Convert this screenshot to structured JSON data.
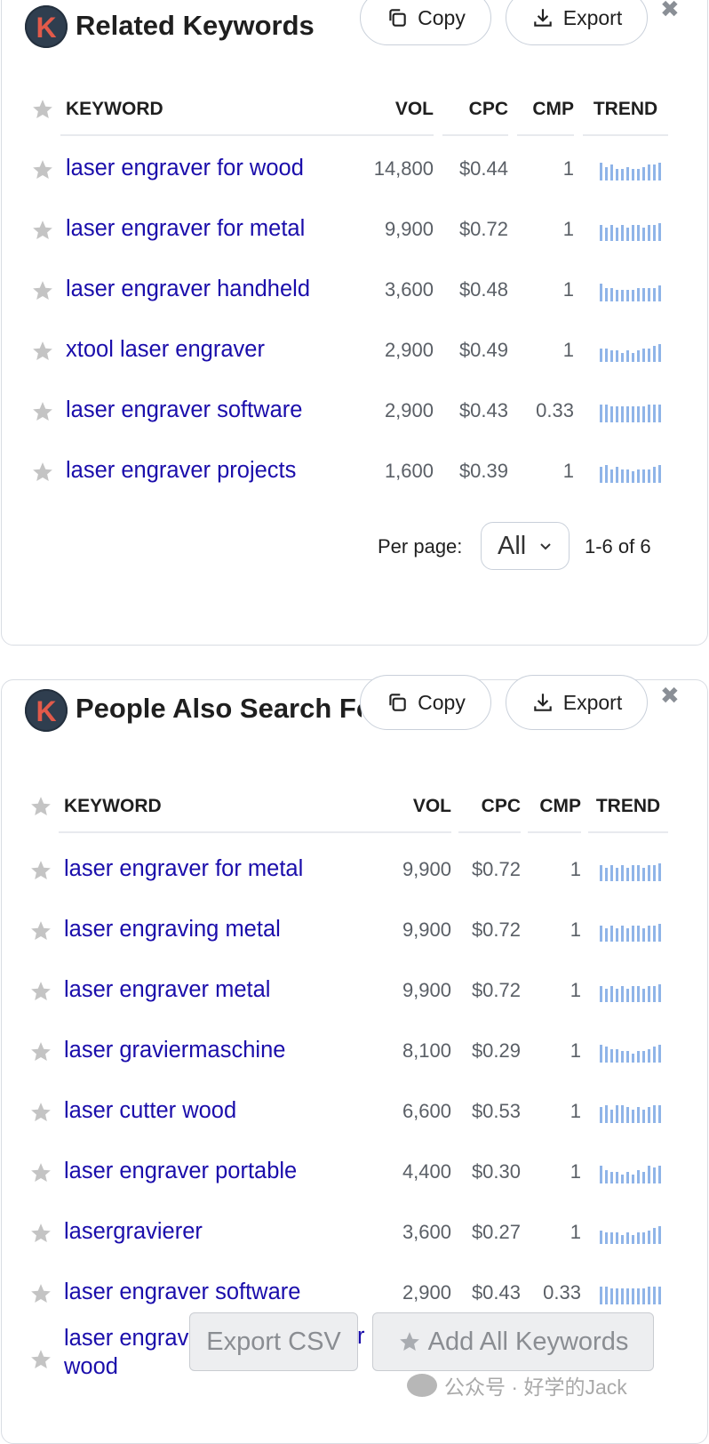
{
  "widgets": [
    {
      "title": "Related Keywords",
      "logo_letter": "K",
      "copy_label": "Copy",
      "export_label": "Export",
      "columns": {
        "keyword": "KEYWORD",
        "vol": "VOL",
        "cpc": "CPC",
        "cmp": "CMP",
        "trend": "TREND"
      },
      "rows": [
        {
          "keyword": "laser engraver for wood",
          "vol": "14,800",
          "cpc": "$0.44",
          "cmp": "1",
          "trend": [
            8,
            6,
            7,
            5,
            5,
            6,
            5,
            5,
            6,
            7,
            7,
            8
          ]
        },
        {
          "keyword": "laser engraver for metal",
          "vol": "9,900",
          "cpc": "$0.72",
          "cmp": "1",
          "trend": [
            7,
            6,
            7,
            6,
            7,
            6,
            7,
            7,
            6,
            7,
            7,
            8
          ]
        },
        {
          "keyword": "laser engraver handheld",
          "vol": "3,600",
          "cpc": "$0.48",
          "cmp": "1",
          "trend": [
            8,
            6,
            6,
            5,
            5,
            5,
            5,
            6,
            6,
            6,
            6,
            7
          ]
        },
        {
          "keyword": "xtool laser engraver",
          "vol": "2,900",
          "cpc": "$0.49",
          "cmp": "1",
          "trend": [
            6,
            6,
            5,
            5,
            4,
            5,
            4,
            5,
            6,
            6,
            7,
            8
          ]
        },
        {
          "keyword": "laser engraver software",
          "vol": "2,900",
          "cpc": "$0.43",
          "cmp": "0.33",
          "trend": [
            8,
            8,
            7,
            7,
            7,
            7,
            7,
            7,
            7,
            8,
            8,
            8
          ]
        },
        {
          "keyword": "laser engraver projects",
          "vol": "1,600",
          "cpc": "$0.39",
          "cmp": "1",
          "trend": [
            7,
            8,
            6,
            7,
            6,
            6,
            5,
            6,
            6,
            6,
            7,
            8
          ]
        }
      ],
      "pagination": {
        "per_page_label": "Per page:",
        "per_page_value": "All",
        "range": "1-6 of 6"
      }
    },
    {
      "title": "People Also Search For",
      "logo_letter": "K",
      "copy_label": "Copy",
      "export_label": "Export",
      "columns": {
        "keyword": "KEYWORD",
        "vol": "VOL",
        "cpc": "CPC",
        "cmp": "CMP",
        "trend": "TREND"
      },
      "rows": [
        {
          "keyword": "laser engraver for metal",
          "vol": "9,900",
          "cpc": "$0.72",
          "cmp": "1",
          "trend": [
            7,
            6,
            7,
            6,
            7,
            6,
            7,
            7,
            6,
            7,
            7,
            8
          ]
        },
        {
          "keyword": "laser engraving metal",
          "vol": "9,900",
          "cpc": "$0.72",
          "cmp": "1",
          "trend": [
            7,
            6,
            7,
            6,
            7,
            6,
            7,
            7,
            6,
            7,
            7,
            8
          ]
        },
        {
          "keyword": "laser engraver metal",
          "vol": "9,900",
          "cpc": "$0.72",
          "cmp": "1",
          "trend": [
            7,
            6,
            7,
            6,
            7,
            6,
            7,
            7,
            6,
            7,
            7,
            8
          ]
        },
        {
          "keyword": "laser graviermaschine",
          "vol": "8,100",
          "cpc": "$0.29",
          "cmp": "1",
          "trend": [
            8,
            7,
            6,
            6,
            5,
            5,
            4,
            5,
            5,
            6,
            7,
            8
          ]
        },
        {
          "keyword": "laser cutter wood",
          "vol": "6,600",
          "cpc": "$0.53",
          "cmp": "1",
          "trend": [
            7,
            8,
            6,
            8,
            8,
            7,
            6,
            7,
            6,
            7,
            8,
            8
          ]
        },
        {
          "keyword": "laser engraver portable",
          "vol": "4,400",
          "cpc": "$0.30",
          "cmp": "1",
          "trend": [
            8,
            6,
            5,
            5,
            4,
            5,
            4,
            6,
            5,
            8,
            7,
            8
          ]
        },
        {
          "keyword": "lasergravierer",
          "vol": "3,600",
          "cpc": "$0.27",
          "cmp": "1",
          "trend": [
            6,
            5,
            5,
            5,
            4,
            5,
            4,
            5,
            5,
            6,
            7,
            8
          ]
        },
        {
          "keyword": "laser engraver software",
          "vol": "2,900",
          "cpc": "$0.43",
          "cmp": "0.33",
          "trend": [
            8,
            8,
            7,
            7,
            7,
            7,
            7,
            7,
            7,
            8,
            8,
            8
          ]
        },
        {
          "keyword_line1": "laser engrav",
          "keyword_line2": "wood",
          "keyword_fragment_right": "r"
        }
      ]
    }
  ],
  "footer": {
    "export_csv_label": "Export CSV",
    "add_all_label": "Add All Keywords",
    "watermark_text": "公众号 · 好学的Jack"
  },
  "colors": {
    "keyword_link": "#1a0dab",
    "trend_bar": "#8fb4e8",
    "logo_bg": "#2f3e4f",
    "logo_letter": "#e25a4a"
  }
}
